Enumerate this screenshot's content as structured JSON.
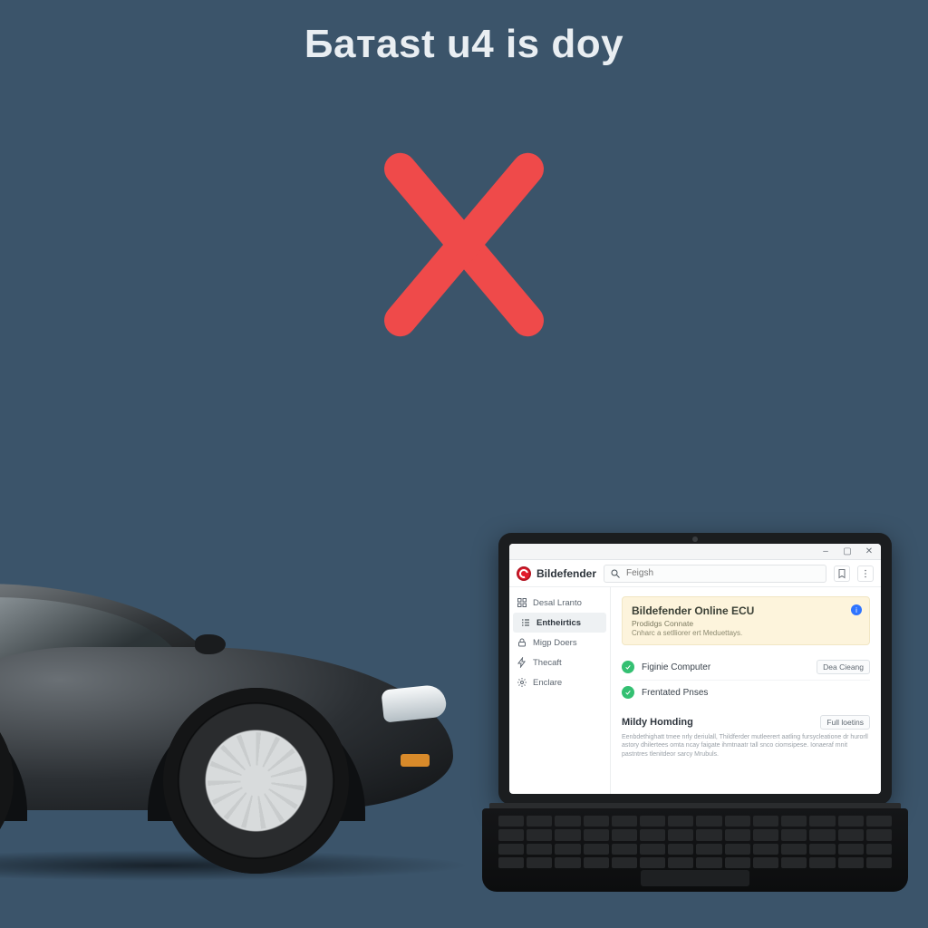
{
  "headline": "Батast u4 is doy",
  "app": {
    "brand": "Bildefender",
    "search_placeholder": "Feigsh",
    "window_buttons": {
      "min": "–",
      "max": "▢",
      "close": "✕"
    }
  },
  "sidebar": {
    "items": [
      {
        "id": "overview",
        "label": "Desal Lranto",
        "icon": "dashboard-icon"
      },
      {
        "id": "protection",
        "label": "Entheirtics",
        "icon": "checklist-icon",
        "active": true
      },
      {
        "id": "privacy",
        "label": "Migp Doers",
        "icon": "lock-icon"
      },
      {
        "id": "utilities",
        "label": "Thecaft",
        "icon": "lightning-icon"
      },
      {
        "id": "settings",
        "label": "Enclare",
        "icon": "gear-icon"
      }
    ]
  },
  "banner": {
    "title": "Bildefender Online ECU",
    "subtitle": "Prodidgs Connate",
    "description": "Cnharc a setlliorer ert Meduettays.",
    "info_badge": "i"
  },
  "status": {
    "items": [
      {
        "label": "Figinie Computer",
        "button": "Dea Cieang"
      },
      {
        "label": "Frentated Pnses"
      }
    ]
  },
  "section": {
    "heading": "Mildy Homding",
    "button": "Full loetins",
    "paragraph": "Eenbdethighatt tmee nrly deriulall, Thildferder mutleerert aatling fursycleatione dr hurorll astory dhilertees omta ncay faigate ihmtnaatr tall snco ciomsipese. Ionaeraf mnit pastntres tlenitdeor sarcy Mrubuls."
  },
  "colors": {
    "bg": "#3b546a",
    "x": "#ef4a4a",
    "accent_green": "#34c072",
    "banner_bg": "#fdf4dc",
    "brand_red": "#e21b2c"
  }
}
